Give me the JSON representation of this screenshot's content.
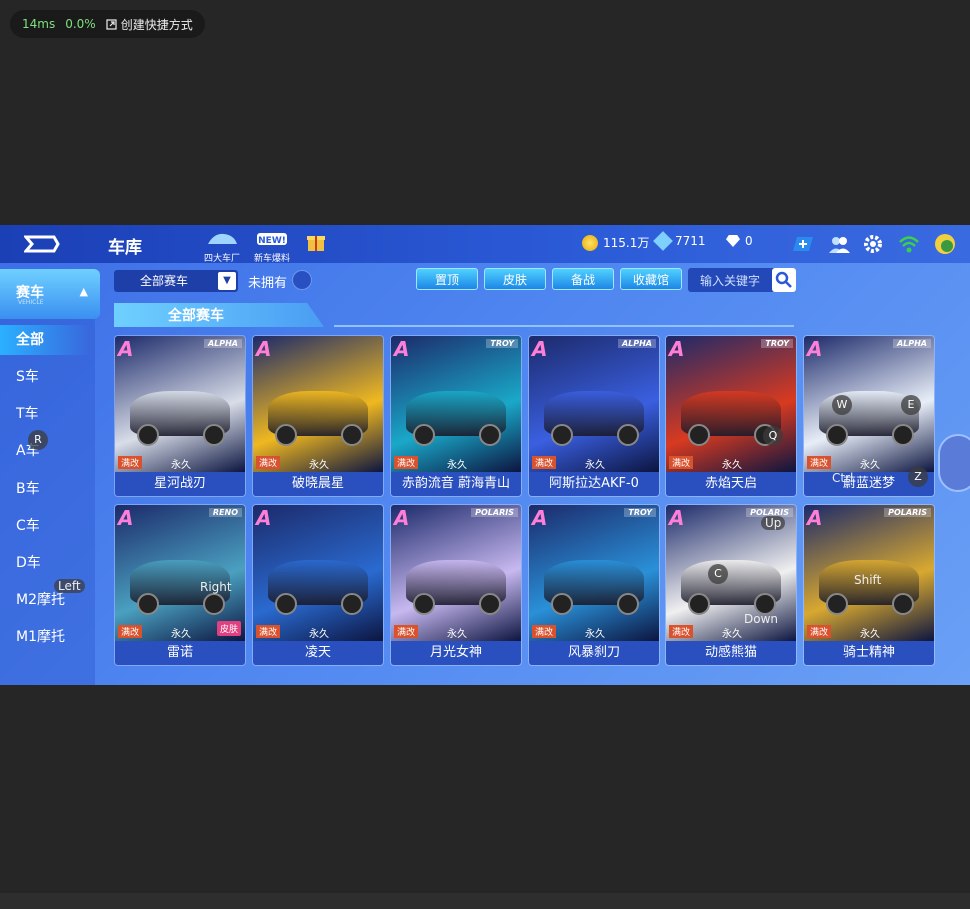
{
  "stats": {
    "latency": "14ms",
    "loss": "0.0%",
    "shortcut": "创建快捷方式"
  },
  "topbar": {
    "title": "车库",
    "icons": [
      {
        "label": "四大车厂"
      },
      {
        "label": "新车爆料"
      },
      {
        "label": ""
      }
    ],
    "coins": "115.1万",
    "gems": "7711",
    "diamonds": "0"
  },
  "sidebar": {
    "header": "赛车",
    "header_sub": "VEHICLE",
    "items": [
      "全部",
      "S车",
      "T车",
      "A车",
      "B车",
      "C车",
      "D车",
      "M2摩托",
      "M1摩托"
    ]
  },
  "filter": {
    "selected": "全部赛车",
    "unowned_label": "未拥有"
  },
  "tabs": [
    "置顶",
    "皮肤",
    "备战",
    "收藏馆"
  ],
  "search": {
    "placeholder": "输入关键字"
  },
  "section_title": "全部赛车",
  "cars": [
    {
      "name": "星河战刃",
      "brand": "ALPHA",
      "badge": "A",
      "mod": "满改",
      "term": "永久",
      "color": "#d8dde8"
    },
    {
      "name": "破晓晨星",
      "brand": "",
      "badge": "A",
      "mod": "满改",
      "term": "永久",
      "color": "#f0b820"
    },
    {
      "name": "赤韵流音 蔚海青山",
      "brand": "TROY",
      "badge": "A",
      "mod": "满改",
      "term": "永久",
      "color": "#1aa8c8"
    },
    {
      "name": "阿斯拉达AKF-0",
      "brand": "ALPHA",
      "badge": "A",
      "mod": "满改",
      "term": "永久",
      "color": "#3a5fe0"
    },
    {
      "name": "赤焰天启",
      "brand": "TROY",
      "badge": "A",
      "mod": "满改",
      "term": "永久",
      "color": "#d83a20"
    },
    {
      "name": "蔚蓝迷梦",
      "brand": "ALPHA",
      "badge": "A",
      "mod": "满改",
      "term": "永久",
      "color": "#e8eef8"
    },
    {
      "name": "雷诺",
      "brand": "RENO",
      "badge": "A",
      "mod": "满改",
      "term": "永久",
      "color": "#4aa0c0"
    },
    {
      "name": "凌天",
      "brand": "",
      "badge": "A",
      "mod": "满改",
      "term": "永久",
      "color": "#2a6ad0"
    },
    {
      "name": "月光女神",
      "brand": "POLARIS",
      "badge": "A",
      "mod": "满改",
      "term": "永久",
      "color": "#c8b8f0"
    },
    {
      "name": "风暴刹刀",
      "brand": "TROY",
      "badge": "A",
      "mod": "满改",
      "term": "永久",
      "color": "#2a90d8"
    },
    {
      "name": "动感熊猫",
      "brand": "POLARIS",
      "badge": "A",
      "mod": "满改",
      "term": "永久",
      "color": "#f0f0f0"
    },
    {
      "name": "骑士精神",
      "brand": "POLARIS",
      "badge": "A",
      "mod": "满改",
      "term": "永久",
      "color": "#d8a830"
    }
  ],
  "skin_tag": "皮肤",
  "keys": {
    "R": "R",
    "Left": "Left",
    "Right": "Right",
    "W": "W",
    "E": "E",
    "Q": "Q",
    "Ctrl": "Ctrl",
    "Z": "Z",
    "Up": "Up",
    "C": "C",
    "Down": "Down",
    "Shift": "Shift"
  }
}
